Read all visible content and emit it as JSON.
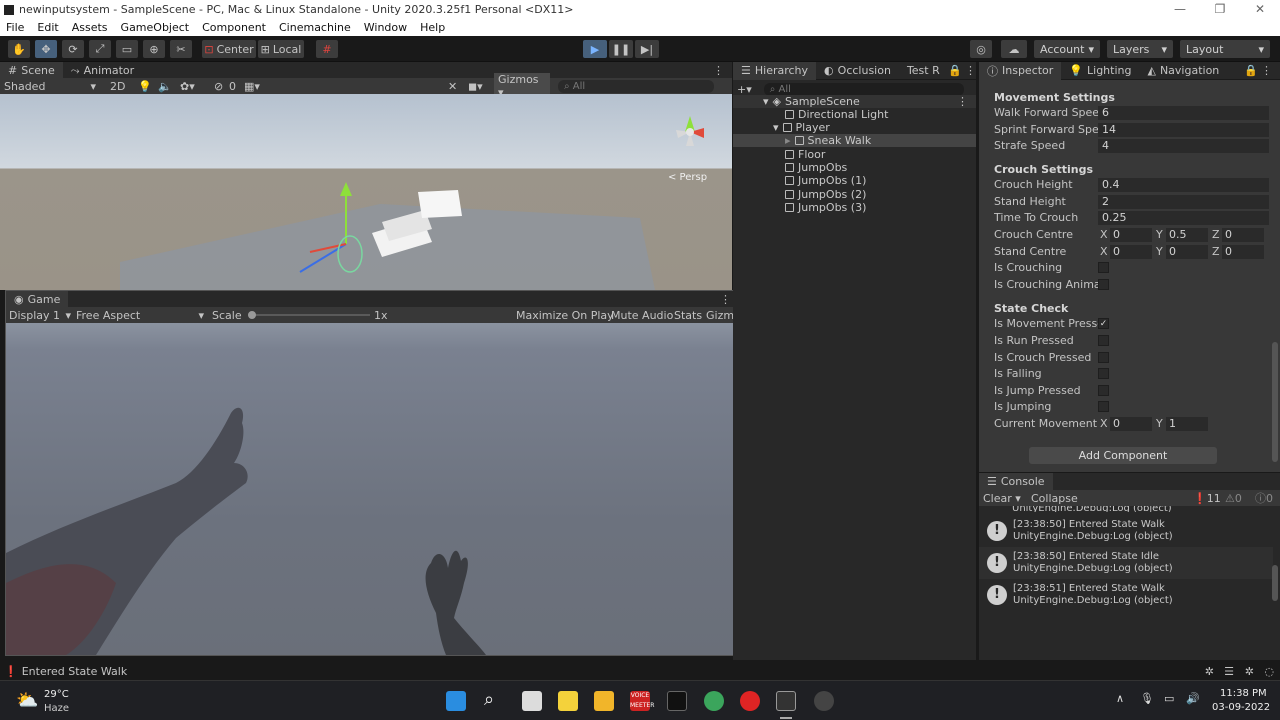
{
  "window": {
    "title": "newinputsystem - SampleScene - PC, Mac & Linux Standalone - Unity 2020.3.25f1 Personal <DX11>"
  },
  "menu": [
    "File",
    "Edit",
    "Assets",
    "GameObject",
    "Component",
    "Cinemachine",
    "Window",
    "Help"
  ],
  "toolbar": {
    "center_label": "Center",
    "local_label": "Local",
    "account_label": "Account",
    "layers_label": "Layers",
    "layout_label": "Layout"
  },
  "scene": {
    "tabs": [
      "Scene",
      "Animator"
    ],
    "shading": "Shaded",
    "mode_2d": "2D",
    "hidden_count": "0",
    "gizmos": "Gizmos",
    "search_placeholder": "All",
    "persp": "< Persp"
  },
  "game": {
    "tab": "Game",
    "display": "Display 1",
    "aspect": "Free Aspect",
    "scale_label": "Scale",
    "scale_value": "1x",
    "scale_fraction": 0.0,
    "maximize": "Maximize On Play",
    "mute": "Mute Audio",
    "stats": "Stats",
    "gizmos": "Gizmos"
  },
  "hierarchy": {
    "tabs": [
      "Hierarchy",
      "Occlusion",
      "Test R"
    ],
    "search_placeholder": "All",
    "scene": "SampleScene",
    "items": [
      "Directional Light",
      "Player",
      "Sneak Walk",
      "Floor",
      "JumpObs",
      "JumpObs (1)",
      "JumpObs (2)",
      "JumpObs (3)"
    ]
  },
  "inspector": {
    "tabs": [
      "Inspector",
      "Lighting",
      "Navigation"
    ],
    "movement": {
      "header": "Movement Settings",
      "walk_label": "Walk Forward Speed",
      "walk": "6",
      "sprint_label": "Sprint Forward Speed",
      "sprint": "14",
      "strafe_label": "Strafe Speed",
      "strafe": "4"
    },
    "crouch": {
      "header": "Crouch Settings",
      "ch_label": "Crouch Height",
      "ch": "0.4",
      "sh_label": "Stand Height",
      "sh": "2",
      "ttc_label": "Time To Crouch",
      "ttc": "0.25",
      "cc_label": "Crouch Centre",
      "cc_x": "0",
      "cc_y": "0.5",
      "cc_z": "0",
      "sc_label": "Stand Centre",
      "sc_x": "0",
      "sc_y": "0",
      "sc_z": "0",
      "isc_label": "Is Crouching",
      "isca_label": "Is Crouching Animation"
    },
    "state": {
      "header": "State Check",
      "mp_label": "Is Movement Pressed",
      "rp_label": "Is Run Pressed",
      "cp_label": "Is Crouch Pressed",
      "f_label": "Is Falling",
      "jp_label": "Is Jump Pressed",
      "j_label": "Is Jumping",
      "cmi_label": "Current Movement Input",
      "cmi_x": "0",
      "cmi_y": "1",
      "check": "✓"
    },
    "axis": {
      "x": "X",
      "y": "Y",
      "z": "Z"
    },
    "add_component": "Add Component"
  },
  "console": {
    "tab": "Console",
    "clear": "Clear",
    "collapse": "Collapse",
    "warn_count": "11",
    "err_count": "0",
    "info_count": "0",
    "partial": "UnityEngine.Debug:Log (object)",
    "entries": [
      {
        "line1": "[23:38:50] Entered State Walk",
        "line2": "UnityEngine.Debug:Log (object)"
      },
      {
        "line1": "[23:38:50] Entered State Idle",
        "line2": "UnityEngine.Debug:Log (object)"
      },
      {
        "line1": "[23:38:51] Entered State Walk",
        "line2": "UnityEngine.Debug:Log (object)"
      }
    ]
  },
  "status": {
    "message": "Entered State Walk"
  },
  "taskbar": {
    "temp": "29°C",
    "weather": "Haze",
    "time": "11:38 PM",
    "date": "03-09-2022",
    "voice_line1": "VOICE",
    "voice_line2": "MEETER"
  }
}
